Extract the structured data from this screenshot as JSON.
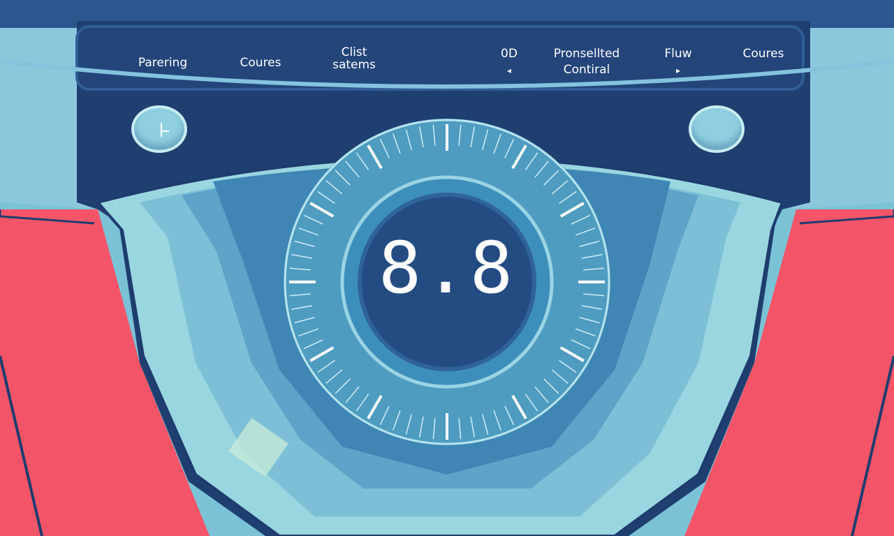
{
  "nav": {
    "items": [
      {
        "label_line1": "Parering",
        "label_line2": ""
      },
      {
        "label_line1": "Coures",
        "label_line2": ""
      },
      {
        "label_line1": "Clist",
        "label_line2": "satems"
      },
      {
        "label_line1": "0D",
        "label_line2": "",
        "arrow": "◂"
      },
      {
        "label_line1": "Pronsellted",
        "label_line2": "Contiral"
      },
      {
        "label_line1": "Fluw",
        "label_line2": "",
        "arrow": "▸"
      },
      {
        "label_line1": "Coures",
        "label_line2": ""
      }
    ]
  },
  "display": {
    "readout": "8.8"
  },
  "icons": {
    "left_button": "clock-icon",
    "right_button": "blank-circle-icon",
    "left_arrow": "caret-left-icon",
    "right_arrow": "caret-right-icon"
  },
  "colors": {
    "navy": "#264f86",
    "dark_navy": "#1e3c6e",
    "sky": "#7cc2d6",
    "coral": "#f45468",
    "dial": "#4f9fc0",
    "white": "#ffffff"
  }
}
